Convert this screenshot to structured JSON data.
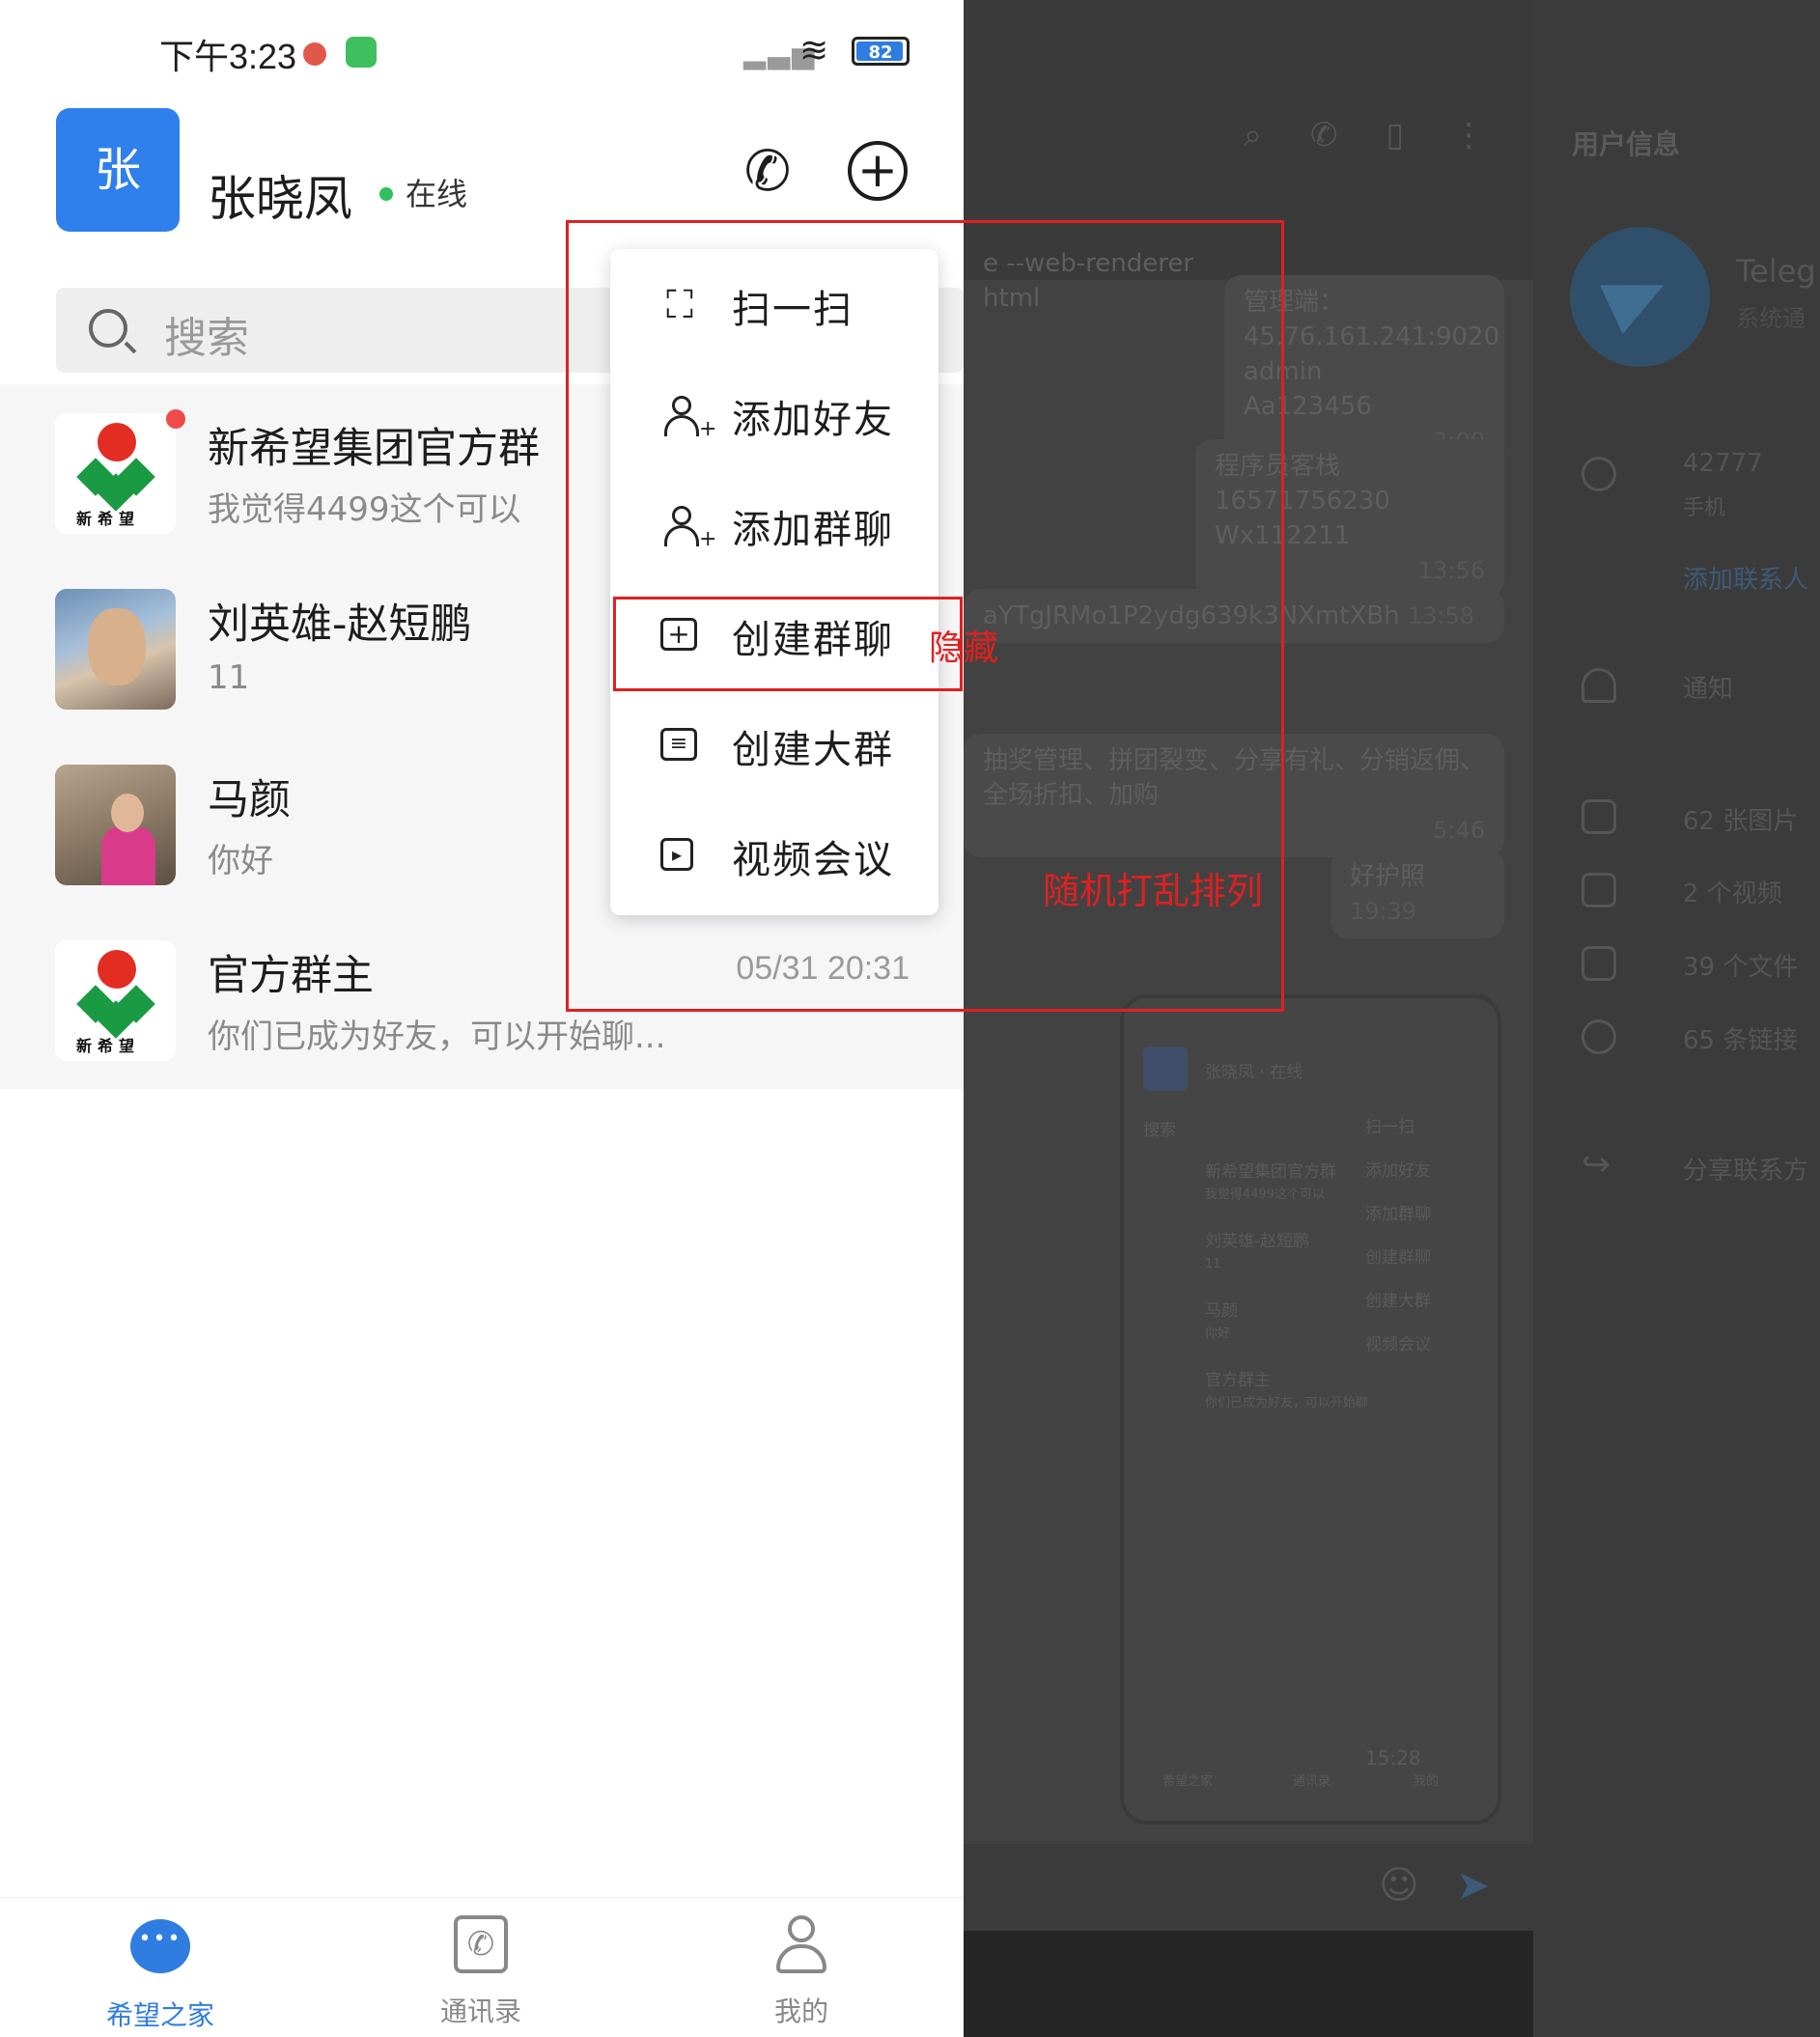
{
  "status_bar": {
    "time": "下午3:23",
    "battery": "82"
  },
  "header": {
    "avatar_char": "张",
    "name": "张晓凤",
    "presence": "在线"
  },
  "search": {
    "placeholder": "搜索"
  },
  "conversations": [
    {
      "title": "新希望集团官方群",
      "subtitle": "我觉得4499这个可以",
      "time": "",
      "avatar": "logo",
      "unread": true,
      "logo_text": "新希望"
    },
    {
      "title": "刘英雄-赵短鹏",
      "subtitle": "11",
      "time": "",
      "avatar": "photo-man",
      "unread": false
    },
    {
      "title": "马颜",
      "subtitle": "你好",
      "time": "",
      "avatar": "photo-woman",
      "unread": false
    },
    {
      "title": "官方群主",
      "subtitle": "你们已成为好友，可以开始聊...",
      "time": "05/31 20:31",
      "avatar": "logo",
      "unread": false,
      "logo_text": "新希望"
    }
  ],
  "menu": {
    "items": [
      {
        "label": "扫一扫",
        "icon": "scan-icon"
      },
      {
        "label": "添加好友",
        "icon": "add-friend-icon"
      },
      {
        "label": "添加群聊",
        "icon": "add-group-icon"
      },
      {
        "label": "创建群聊",
        "icon": "create-group-chat-icon"
      },
      {
        "label": "创建大群",
        "icon": "create-large-group-icon"
      },
      {
        "label": "视频会议",
        "icon": "video-meeting-icon"
      }
    ]
  },
  "annotations": {
    "hide": "隐藏",
    "shuffle": "随机打乱排列"
  },
  "tabbar": {
    "tabs": [
      {
        "label": "希望之家",
        "icon": "chat-icon",
        "active": true
      },
      {
        "label": "通讯录",
        "icon": "contacts-icon",
        "active": false
      },
      {
        "label": "我的",
        "icon": "profile-icon",
        "active": false
      }
    ]
  },
  "background": {
    "chat_lines": [
      "e --web-renderer html",
      "管理端：",
      "45.76.161.241:9020",
      "admin",
      "Aa123456",
      "3:00",
      "程序员客栈",
      "16571756230",
      "Wx112211",
      "13:56",
      "aYTgJRMo1P2ydg639k3NXmtXBh",
      "13:58",
      "抽奖管理、拼团裂变、分享有礼、分销返佣、",
      "全场折扣、加购",
      "5:46",
      "好护照",
      "19:39"
    ],
    "info_title": "用户信息",
    "info_name": "Teleg",
    "info_sub": "系统通",
    "info_rows": [
      {
        "text": "42777",
        "sub": "手机"
      },
      {
        "text": "添加联系人"
      },
      {
        "text": "通知"
      },
      {
        "text": "62 张图片"
      },
      {
        "text": "2 个视频"
      },
      {
        "text": "39 个文件"
      },
      {
        "text": "65 条链接"
      },
      {
        "text": "分享联系方"
      }
    ],
    "mini_phone": {
      "name": "张晓凤",
      "presence": "在线",
      "search": "搜索",
      "menu": [
        "扫一扫",
        "添加好友",
        "添加群聊",
        "创建群聊",
        "创建大群",
        "视频会议"
      ],
      "convs": [
        "新希望集团官方群",
        "我觉得4499这个可以",
        "刘英雄-赵短鹏",
        "11",
        "马颜",
        "你好",
        "官方群主",
        "你们已成为好友，可以开始聊"
      ],
      "tabs": [
        "希望之家",
        "通讯录",
        "我的"
      ],
      "time": "15:28"
    }
  }
}
